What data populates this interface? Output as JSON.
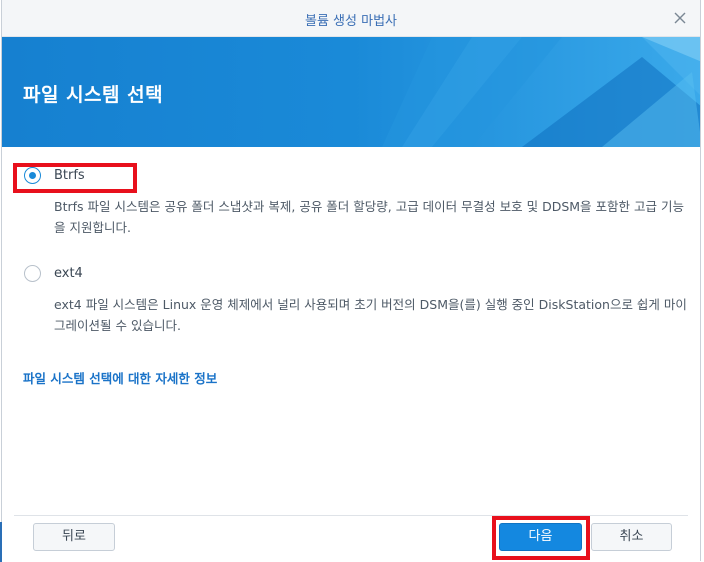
{
  "window": {
    "title": "볼륨 생성 마법사"
  },
  "banner": {
    "title": "파일 시스템 선택"
  },
  "options": [
    {
      "label": "Btrfs",
      "selected": true,
      "description": "Btrfs 파일 시스템은 공유 폴더 스냅샷과 복제, 공유 폴더 할당량, 고급 데이터 무결성 보호 및 DDSM을 포함한 고급 기능을 지원합니다."
    },
    {
      "label": "ext4",
      "selected": false,
      "description": "ext4 파일 시스템은 Linux 운영 체제에서 널리 사용되며 초기 버전의 DSM을(를) 실행 중인 DiskStation으로 쉽게 마이그레이션될 수 있습니다."
    }
  ],
  "info_link": "파일 시스템 선택에 대한 자세한 정보",
  "footer": {
    "back_label": "뒤로",
    "next_label": "다음",
    "cancel_label": "취소"
  },
  "colors": {
    "accent": "#1488e0",
    "banner": "#1a89d6",
    "highlight": "#e8101c",
    "link": "#1a73c8"
  }
}
